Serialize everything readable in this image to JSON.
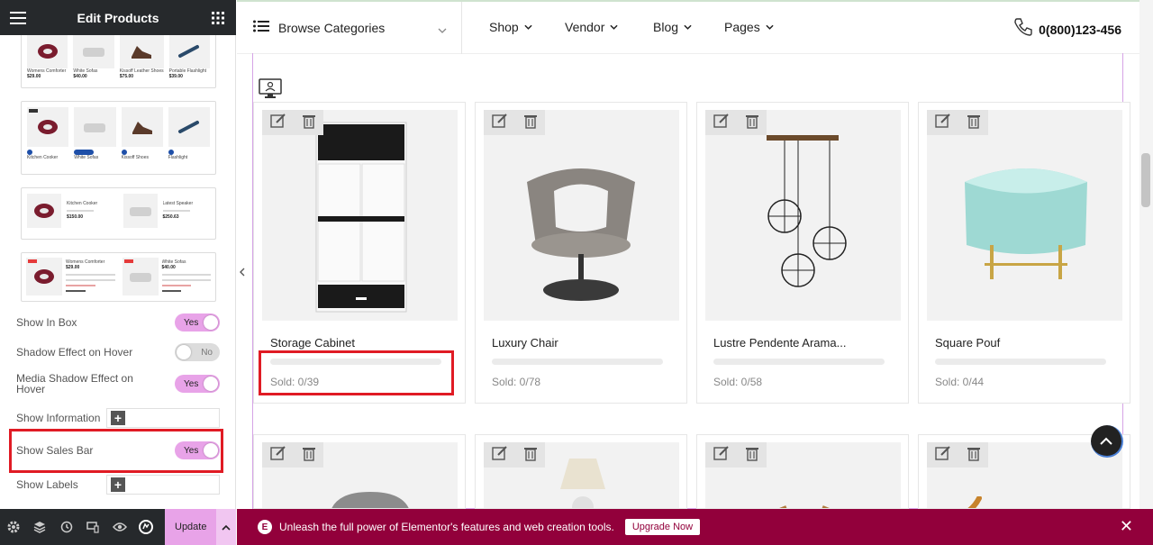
{
  "panel": {
    "title": "Edit Products",
    "presets": [
      {
        "items": [
          {
            "name": "Womens Comforter",
            "price": "$29.00"
          },
          {
            "name": "White Sofas",
            "price": "$40.00"
          },
          {
            "name": "Kissoff Leather Shoes",
            "price": "$75.00"
          },
          {
            "name": "Portable Flashlight",
            "price": "$39.00"
          }
        ]
      },
      {
        "items": [
          {
            "name": "Kitchen Cooker"
          },
          {
            "name": "White Sofas"
          },
          {
            "name": "Kissoff Shoes"
          },
          {
            "name": "Flashlight"
          }
        ]
      },
      {
        "items": [
          {
            "name": "Kitchen Cooker",
            "price": "$150.00"
          },
          {
            "name": "Latest Speaker",
            "price": "$250.63"
          }
        ]
      },
      {
        "items": [
          {
            "name": "Womens Comforter",
            "price": "$29.00"
          },
          {
            "name": "White Sofas",
            "price": "$40.00"
          }
        ]
      }
    ],
    "options": {
      "show_in_box": {
        "label": "Show In Box",
        "value": "Yes"
      },
      "shadow_hover": {
        "label": "Shadow Effect on Hover",
        "value": "No"
      },
      "media_shadow": {
        "label": "Media Shadow Effect on Hover",
        "value": "Yes"
      },
      "show_information": {
        "label": "Show Information",
        "plus": "+"
      },
      "show_sales_bar": {
        "label": "Show Sales Bar",
        "value": "Yes"
      },
      "show_labels": {
        "label": "Show Labels",
        "plus": "+"
      }
    },
    "footer": {
      "update_label": "Update"
    }
  },
  "header": {
    "browse_label": "Browse Categories",
    "nav": [
      "Shop",
      "Vendor",
      "Blog",
      "Pages"
    ],
    "phone": "0(800)123-456"
  },
  "products": [
    {
      "title": "Storage Cabinet",
      "sold": "Sold: 0/39"
    },
    {
      "title": "Luxury Chair",
      "sold": "Sold: 0/78"
    },
    {
      "title": "Lustre Pendente Arama...",
      "sold": "Sold: 0/58"
    },
    {
      "title": "Square Pouf",
      "sold": "Sold: 0/44"
    }
  ],
  "promo": {
    "text": "Unleash the full power of Elementor's features and web creation tools.",
    "button": "Upgrade Now",
    "close": "✕",
    "icon": "E"
  },
  "colors": {
    "accent_pink": "#e8a3e8",
    "promo_bg": "#92003b",
    "highlight_red": "#e01b24"
  }
}
